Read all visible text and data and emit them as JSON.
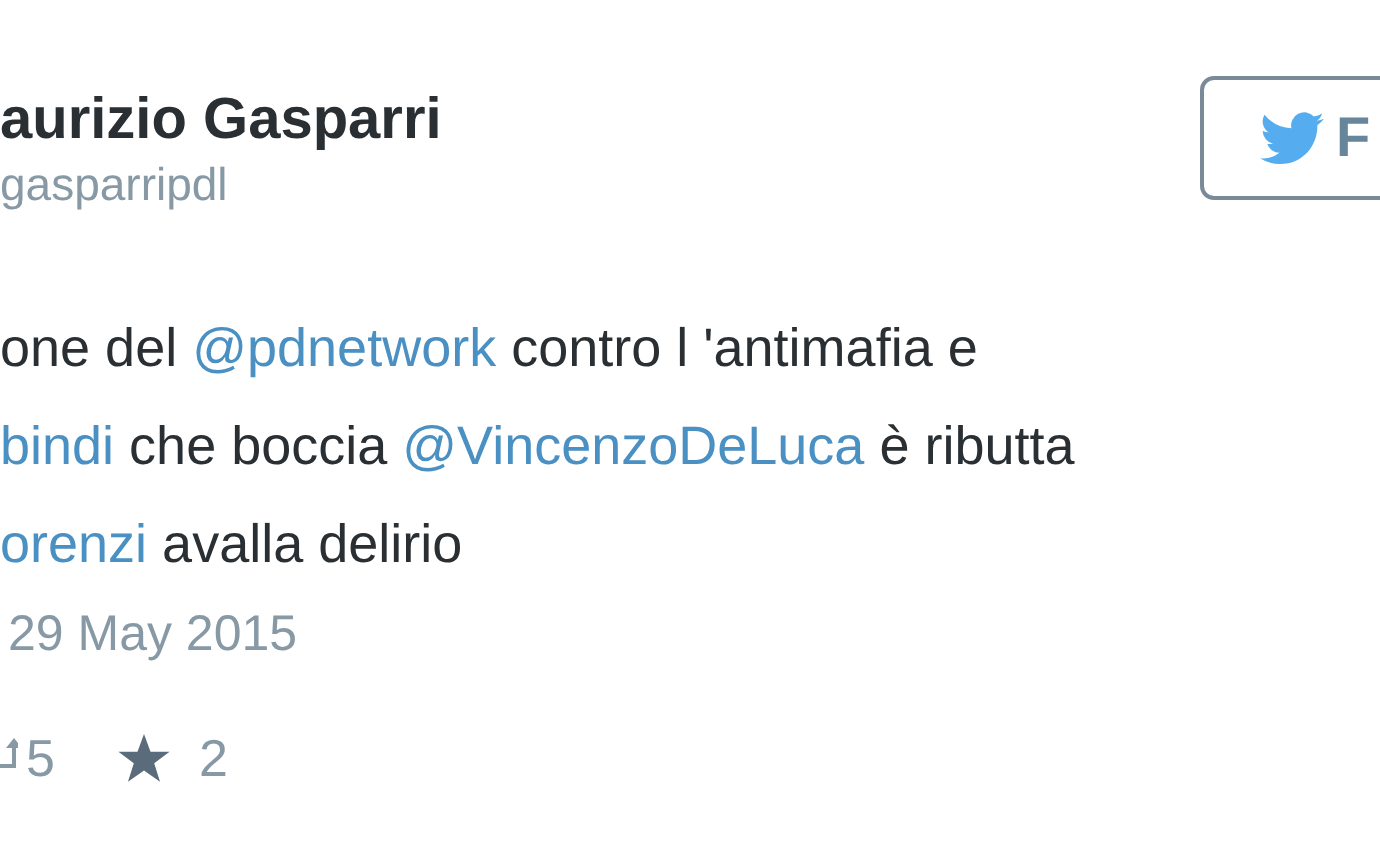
{
  "author": {
    "name": "aurizio Gasparri",
    "handle": "gasparripdl"
  },
  "follow_button": {
    "label": "F"
  },
  "tweet_lines": [
    [
      {
        "kind": "plain",
        "text": "one del "
      },
      {
        "kind": "link",
        "text": "@pdnetwork"
      },
      {
        "kind": "plain",
        "text": " contro l 'antimafia e"
      }
    ],
    [
      {
        "kind": "link",
        "text": "bindi"
      },
      {
        "kind": "plain",
        "text": " che boccia "
      },
      {
        "kind": "link",
        "text": "@VincenzoDeLuca"
      },
      {
        "kind": "plain",
        "text": " è ributta"
      }
    ],
    [
      {
        "kind": "link",
        "text": "orenzi"
      },
      {
        "kind": "plain",
        "text": " avalla delirio"
      }
    ]
  ],
  "date": "29 May 2015",
  "stats": {
    "retweets": "5",
    "favorites": "2"
  }
}
